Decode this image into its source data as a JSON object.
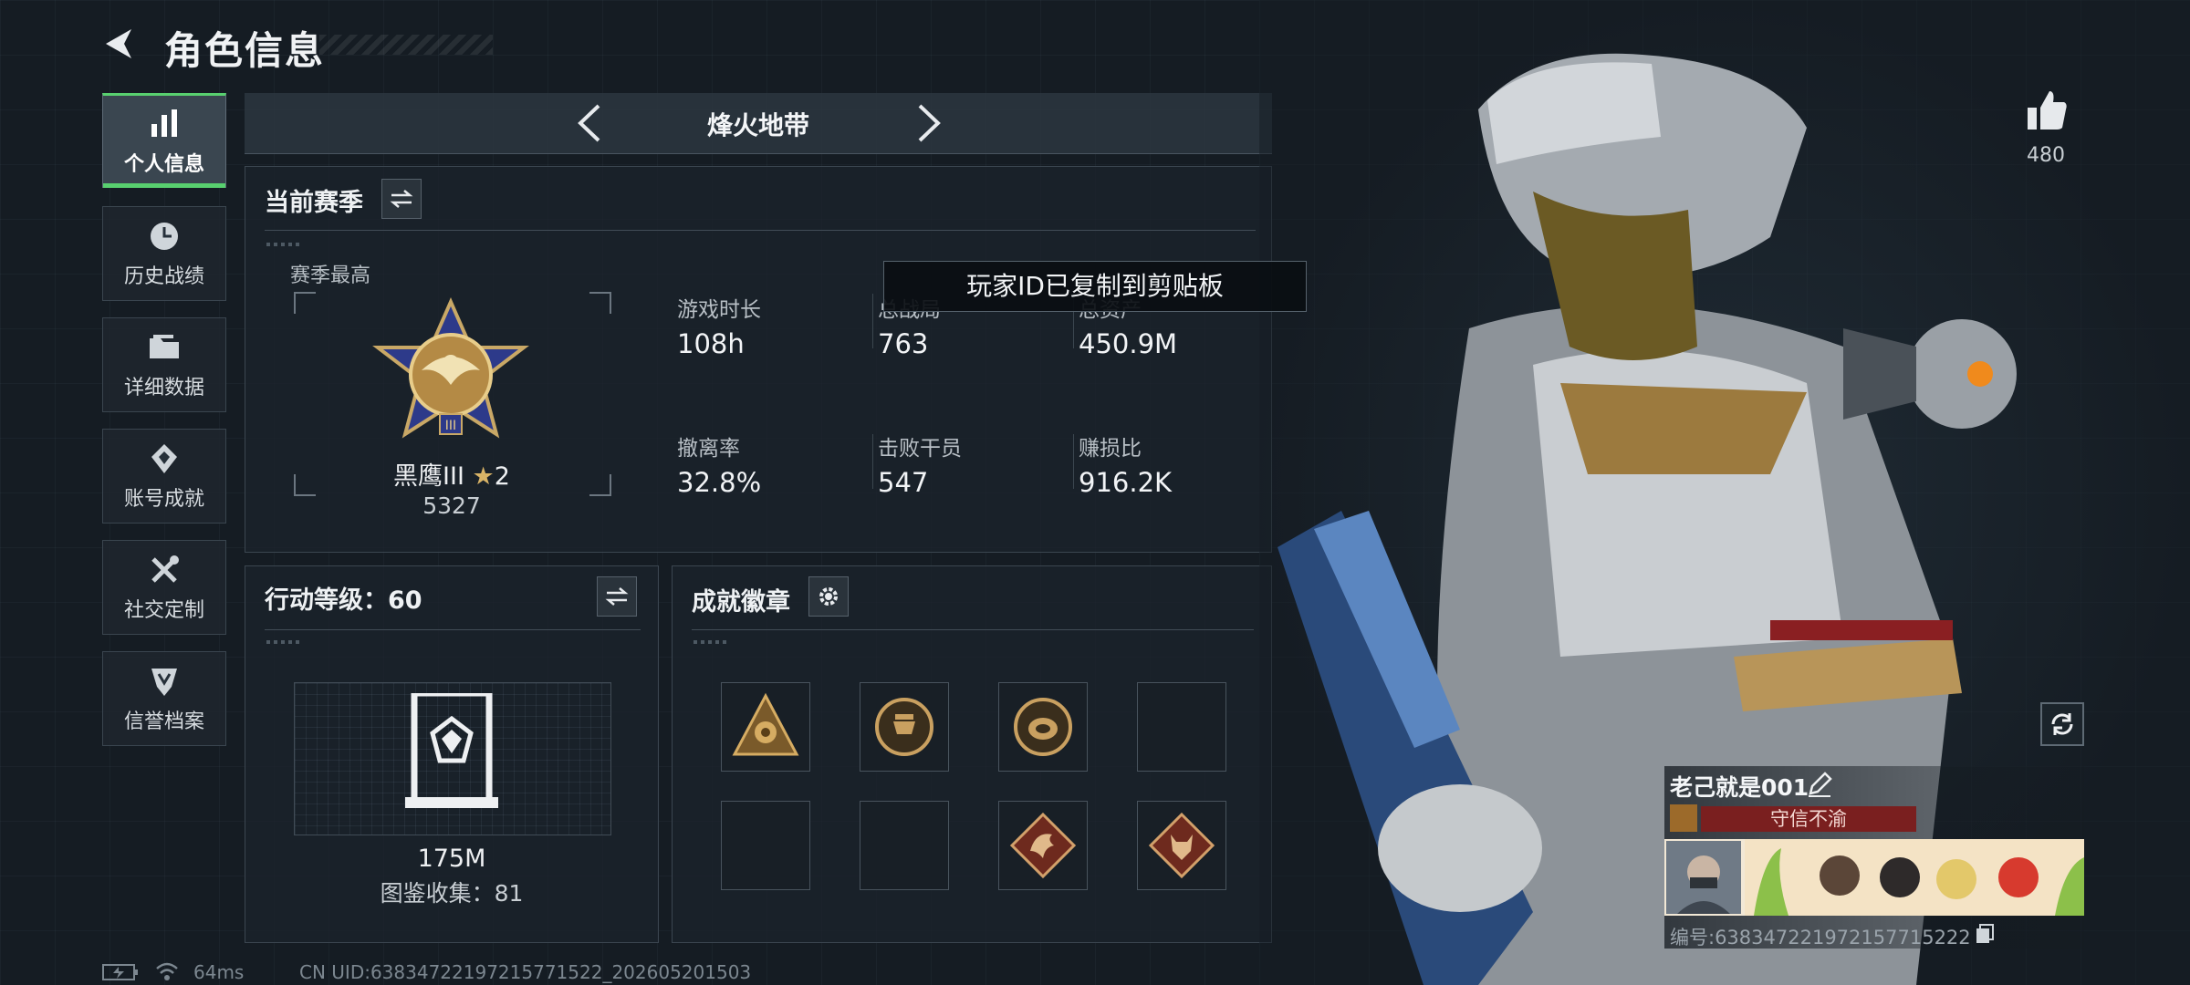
{
  "header": {
    "title": "角色信息"
  },
  "sidebar": {
    "items": [
      {
        "label": "个人信息",
        "icon": "bar-chart-icon",
        "active": true
      },
      {
        "label": "历史战绩",
        "icon": "clock-icon",
        "active": false
      },
      {
        "label": "详细数据",
        "icon": "folder-icon",
        "active": false
      },
      {
        "label": "账号成就",
        "icon": "achievement-icon",
        "active": false
      },
      {
        "label": "社交定制",
        "icon": "tools-icon",
        "active": false
      },
      {
        "label": "信誉档案",
        "icon": "reputation-icon",
        "active": false
      }
    ]
  },
  "mode": {
    "name": "烽火地带"
  },
  "season": {
    "title": "当前赛季",
    "best_label": "赛季最高",
    "rank_name": "黑鹰III",
    "rank_stars": "2",
    "rank_points": "5327",
    "stats": [
      {
        "label": "游戏时长",
        "value": "108h"
      },
      {
        "label": "总战局",
        "value": "763"
      },
      {
        "label": "总资产",
        "value": "450.9M"
      },
      {
        "label": "撤离率",
        "value": "32.8%"
      },
      {
        "label": "击败干员",
        "value": "547"
      },
      {
        "label": "赚损比",
        "value": "916.2K"
      }
    ]
  },
  "toast": {
    "text": "玩家ID已复制到剪贴板"
  },
  "action_level": {
    "title": "行动等级：60",
    "value": "175M",
    "collection": "图鉴收集：81"
  },
  "badges": {
    "title": "成就徽章",
    "slots": [
      {
        "icon": "badge-triangle-emblem-icon",
        "filled": true
      },
      {
        "icon": "badge-round-mask-icon",
        "filled": true
      },
      {
        "icon": "badge-round-shell-icon",
        "filled": true
      },
      {
        "icon": "",
        "filled": false
      },
      {
        "icon": "",
        "filled": false
      },
      {
        "icon": "",
        "filled": false
      },
      {
        "icon": "badge-dragon-diamond-icon",
        "filled": true
      },
      {
        "icon": "badge-wolf-diamond-icon",
        "filled": true
      }
    ]
  },
  "likes": {
    "count": "480"
  },
  "player": {
    "name": "老己就是001",
    "title": "守信不渝",
    "id": "编号:638347221972157715222"
  },
  "footer": {
    "ping": "64ms",
    "uid": "CN UID:6383472219721577152‌2_202605201503"
  },
  "colors": {
    "accent": "#58d06f",
    "title_bg": "#7a1f1f"
  }
}
